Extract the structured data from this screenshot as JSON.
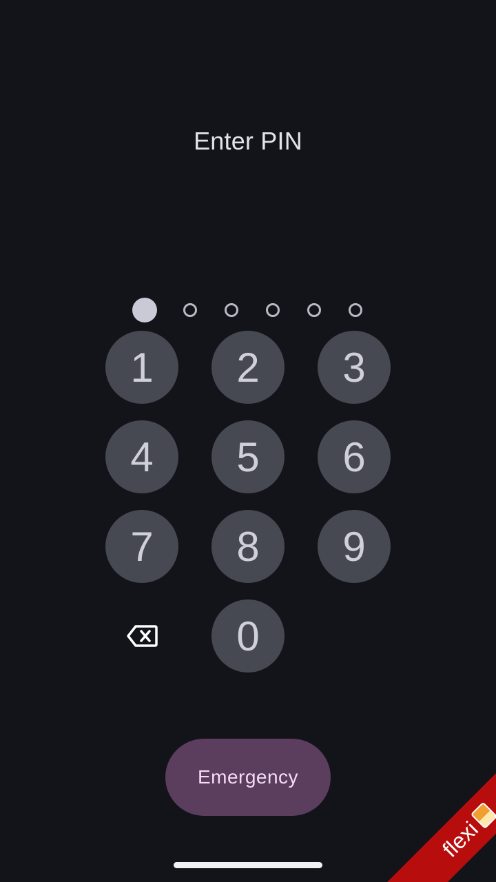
{
  "header": {
    "title": "Enter PIN"
  },
  "pin": {
    "length": 6,
    "entered": 1
  },
  "keypad": {
    "keys": [
      "1",
      "2",
      "3",
      "4",
      "5",
      "6",
      "7",
      "8",
      "9",
      "0"
    ],
    "backspace_icon": "backspace-icon"
  },
  "actions": {
    "emergency_label": "Emergency"
  },
  "badge": {
    "label": "flexi",
    "icon": "beer-mug-icon"
  },
  "colors": {
    "background": "#131419",
    "key": "#464852",
    "emergency": "#5b3d5e",
    "ribbon": "#b80d0d"
  }
}
